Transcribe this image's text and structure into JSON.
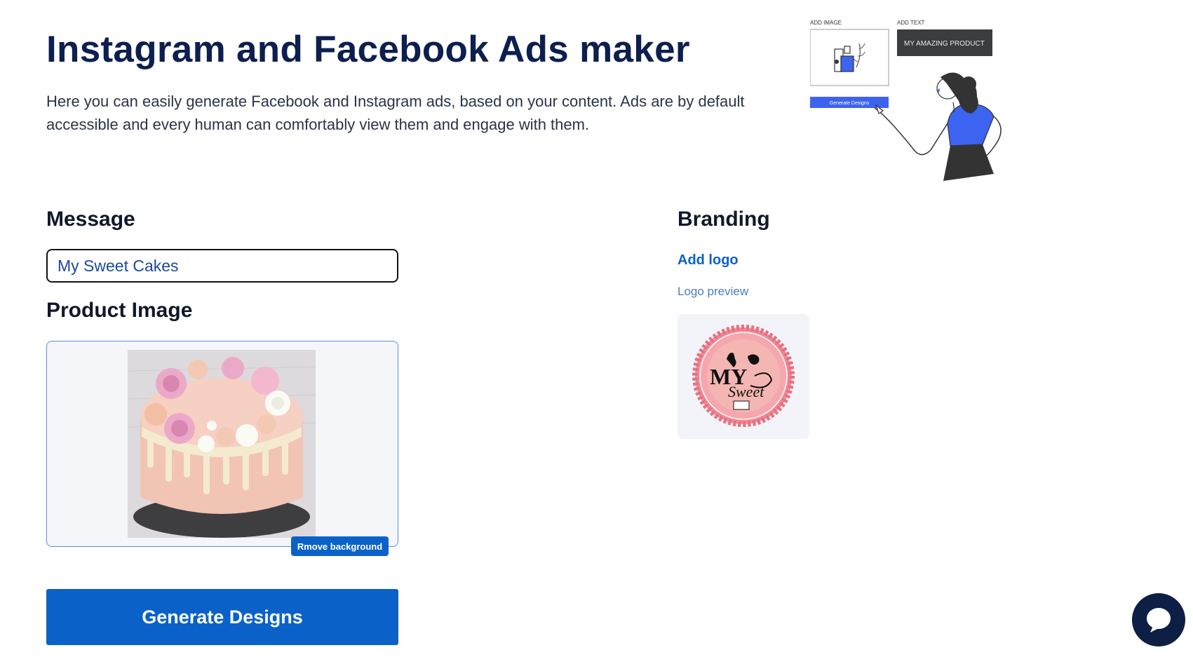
{
  "header": {
    "title": "Instagram and Facebook Ads maker",
    "description": "Here you can easily generate Facebook and Instagram ads, based on your content. Ads are by default accessible and every human can comfortably view them and engage with them."
  },
  "hero": {
    "add_image_label": "ADD IMAGE",
    "add_text_label": "ADD TEXT",
    "sample_text": "MY AMAZING PRODUCT",
    "generate_label": "Generate Designs"
  },
  "message": {
    "heading": "Message",
    "value": "My Sweet Cakes"
  },
  "product_image": {
    "heading": "Product Image",
    "remove_bg_label": "Rmove background"
  },
  "branding": {
    "heading": "Branding",
    "add_logo_label": "Add logo",
    "logo_preview_label": "Logo preview",
    "logo_text_top": "MY",
    "logo_text_bottom": "Sweet"
  },
  "actions": {
    "generate_label": "Generate Designs"
  },
  "icons": {
    "chat": "chat-bubble-icon"
  },
  "colors": {
    "primary": "#0a62c9",
    "title": "#0d1f4f",
    "chat": "#0d1f45",
    "hero_accent": "#3d64f0"
  }
}
